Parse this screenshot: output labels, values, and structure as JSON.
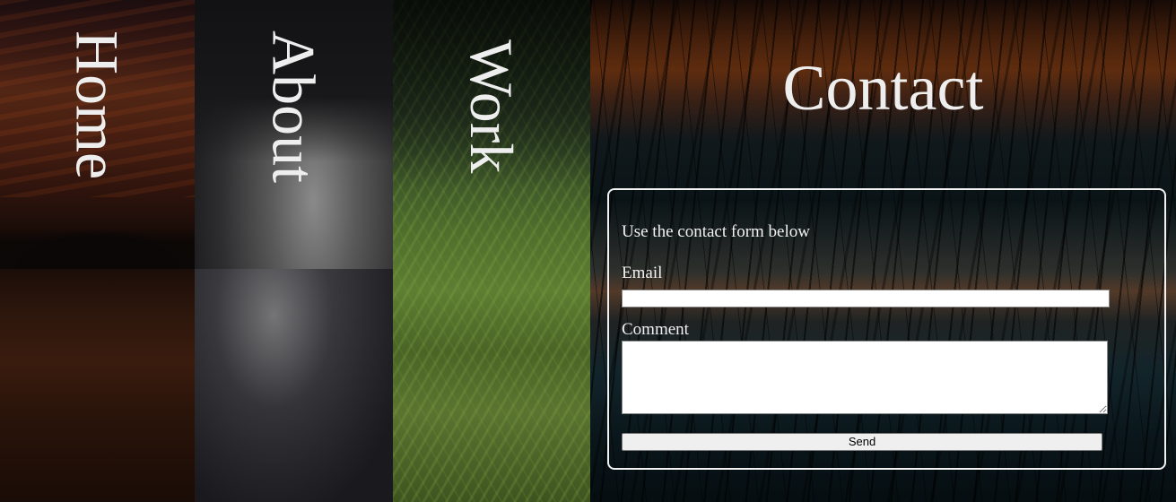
{
  "nav": {
    "home_label": "Home",
    "about_label": "About",
    "work_label": "Work"
  },
  "contact": {
    "heading": "Contact",
    "intro": "Use the contact form below",
    "email_label": "Email",
    "email_value": "",
    "comment_label": "Comment",
    "comment_value": "",
    "send_label": "Send"
  },
  "colors": {
    "text": "#eeeeee",
    "box_border": "#f2f2f2",
    "input_bg": "#ffffff",
    "button_bg": "#efefef"
  }
}
